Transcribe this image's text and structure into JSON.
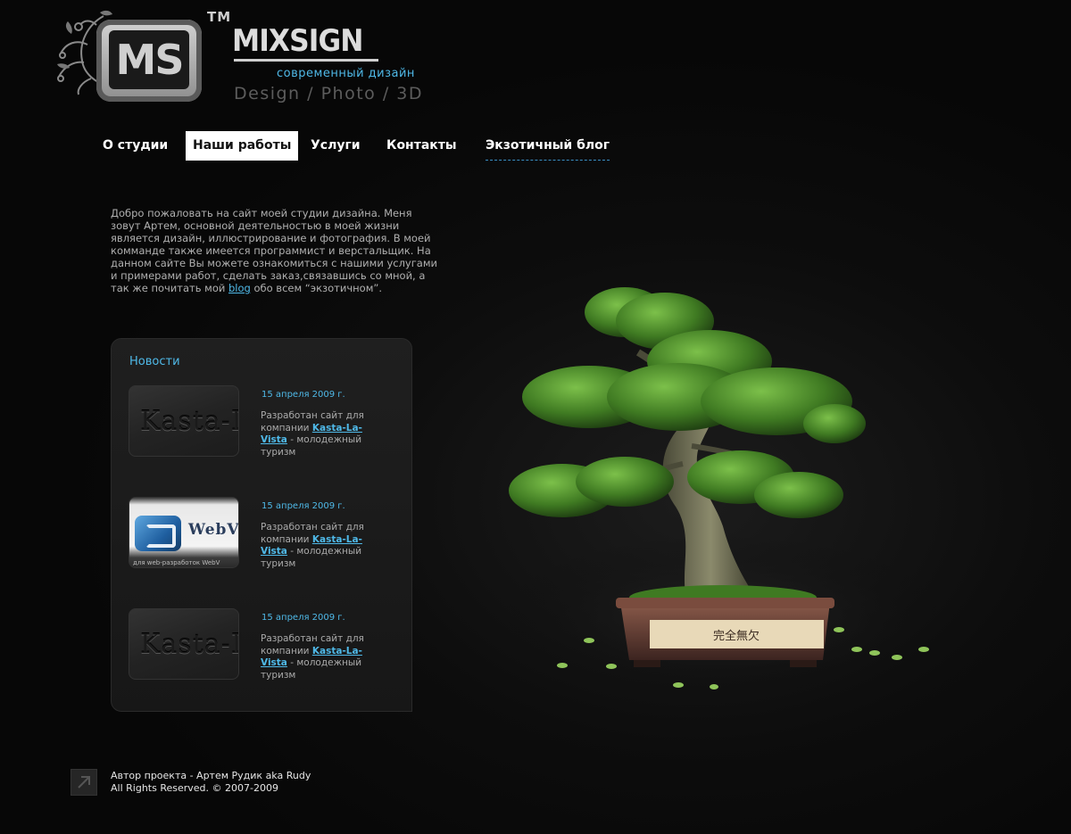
{
  "logo": {
    "badge_text": "MS",
    "trademark": "TM",
    "name": "MIXSIGN",
    "tagline": "современный дизайн",
    "services": "Design / Photo / 3D"
  },
  "nav": {
    "items": [
      {
        "label": "О студии"
      },
      {
        "label": "Наши работы"
      },
      {
        "label": "Услуги"
      },
      {
        "label": "Контакты"
      },
      {
        "label": "Экзотичный блог"
      }
    ],
    "active_index": 1
  },
  "intro": {
    "text_before_link": "Добро пожаловать на сайт моей студии дизайна. Меня зовут Артем, основной деятельностью в моей жизни является дизайн, иллюстрирование и фотография. В моей комманде также имеется программист и верстальщик. На данном сайте Вы можете ознакомиться с нашими услугами и примерами работ, сделать заказ,связавшись со мной, а так же почитать мой",
    "link_label": "blog",
    "text_after_link": "обо всем “экзотичном”."
  },
  "news": {
    "title": "Новости",
    "items": [
      {
        "thumb_text": "Kasta-L",
        "date": "15 апреля 2009 г.",
        "text_before": "Разработан сайт для компании",
        "link": "Kasta-La-Vista",
        "text_after": "- молодежный туризм"
      },
      {
        "thumb_text": "WebV",
        "thumb_strip": "для web-разработок WebV",
        "date": "15 апреля 2009 г.",
        "text_before": "Разработан сайт для компании",
        "link": "Kasta-La-Vista",
        "text_after": "- молодежный туризм"
      },
      {
        "thumb_text": "Kasta-L",
        "date": "15 апреля 2009 г.",
        "text_before": "Разработан сайт для компании",
        "link": "Kasta-La-Vista",
        "text_after": "- молодежный туризм"
      }
    ]
  },
  "bonsai": {
    "plaque_text": "完全無欠"
  },
  "footer": {
    "author": "Автор проекта - Артем Рудик aka Rudy",
    "rights": "All Rights Reserved. © 2007-2009"
  },
  "colors": {
    "background": "#0d0d0d",
    "accent": "#4fb9e8",
    "nav_active_bg": "#ffffff",
    "leaf_green": "#4f8a2a"
  }
}
